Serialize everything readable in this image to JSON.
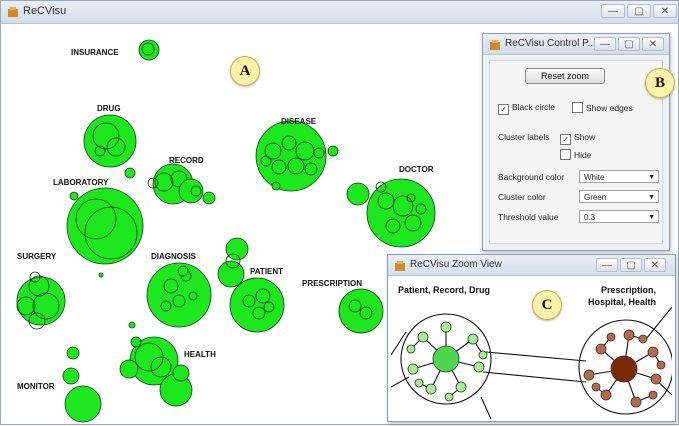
{
  "main_window": {
    "title": "ReCVisu",
    "controls": {
      "minimize": "—",
      "maximize": "▢",
      "close": "✕"
    }
  },
  "badges": {
    "a": "A",
    "b": "B",
    "c": "C"
  },
  "cluster_labels": {
    "insurance": "INSURANCE",
    "drug": "DRUG",
    "disease": "DISEASE",
    "record": "RECORD",
    "doctor": "DOCTOR",
    "laboratory": "LABORATORY",
    "surgery": "SURGERY",
    "diagnosis": "DIAGNOSIS",
    "patient": "PATIENT",
    "prescription": "PRESCRIPTION",
    "health": "HEALTH",
    "monitor": "MONITOR"
  },
  "control_panel": {
    "title": "ReCVisu Control P...",
    "reset_zoom": "Reset zoom",
    "black_circle": {
      "label": "Black circle",
      "checked": true
    },
    "show_edges": {
      "label": "Show edges",
      "checked": false
    },
    "cluster_labels_title": "Cluster labels",
    "labels_show": {
      "label": "Show",
      "checked": true
    },
    "labels_hide": {
      "label": "Hide",
      "checked": false
    },
    "background_color": {
      "label": "Background color",
      "value": "White"
    },
    "cluster_color": {
      "label": "Cluster color",
      "value": "Green"
    },
    "threshold": {
      "label": "Threshold value",
      "value": "0.3"
    }
  },
  "zoom_view": {
    "title": "ReCVisu Zoom View",
    "left_cluster": "Patient, Record, Drug",
    "right_cluster_line1": "Prescription,",
    "right_cluster_line2": "Hospital, Health"
  },
  "colors": {
    "cluster_green": "#1de81d",
    "light_green": "#a8ee94",
    "zoom_center_green": "#4fd64f",
    "brown": "#b5694a",
    "dark_brown": "#7a2a05",
    "badge": "#fff1a8"
  }
}
